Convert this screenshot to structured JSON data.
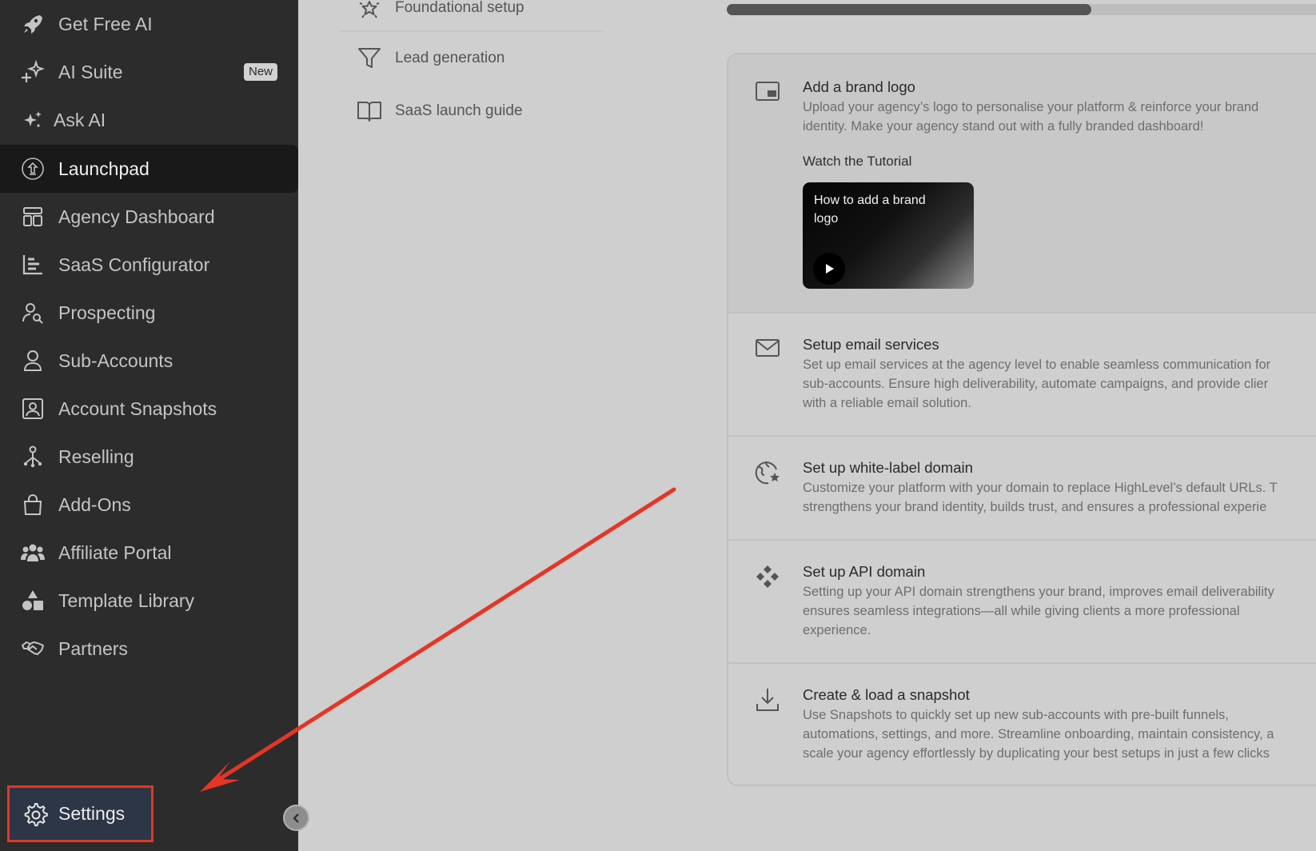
{
  "sidebar": {
    "items": [
      {
        "label": "Get Free AI",
        "icon": "rocket-icon"
      },
      {
        "label": "AI Suite",
        "icon": "sparkle-plus-icon",
        "badge": "New"
      },
      {
        "label": "Ask AI",
        "icon": "sparkles-icon"
      },
      {
        "label": "Launchpad",
        "icon": "launchpad-icon",
        "active": true
      },
      {
        "label": "Agency Dashboard",
        "icon": "dashboard-icon"
      },
      {
        "label": "SaaS Configurator",
        "icon": "bar-chart-icon"
      },
      {
        "label": "Prospecting",
        "icon": "user-search-icon"
      },
      {
        "label": "Sub-Accounts",
        "icon": "user-icon"
      },
      {
        "label": "Account Snapshots",
        "icon": "portrait-icon"
      },
      {
        "label": "Reselling",
        "icon": "network-icon"
      },
      {
        "label": "Add-Ons",
        "icon": "bag-icon"
      },
      {
        "label": "Affiliate Portal",
        "icon": "users-icon"
      },
      {
        "label": "Template Library",
        "icon": "shapes-icon"
      },
      {
        "label": "Partners",
        "icon": "handshake-icon"
      }
    ],
    "settings_label": "Settings"
  },
  "guides": {
    "items": [
      {
        "label": "Foundational setup",
        "icon": "star-sparkle-icon"
      },
      {
        "label": "Lead generation",
        "icon": "funnel-icon"
      },
      {
        "label": "SaaS launch guide",
        "icon": "book-icon"
      }
    ]
  },
  "progress": {
    "fraction": 0.6
  },
  "steps": [
    {
      "title": "Add a brand logo",
      "desc_lines": [
        "Upload your agency’s logo to personalise your platform & reinforce your brand",
        "identity. Make your agency stand out with a fully branded dashboard!"
      ],
      "tutorial_label": "Watch the Tutorial",
      "video_title": "How to add a brand logo"
    },
    {
      "title": "Setup email services",
      "desc_lines": [
        "Set up email services at the agency level to enable seamless communication for",
        "sub-accounts. Ensure high deliverability, automate campaigns, and provide clier",
        "with a reliable email solution."
      ]
    },
    {
      "title": "Set up white-label domain",
      "desc_lines": [
        "Customize your platform with your domain to replace HighLevel’s default URLs. T",
        "strengthens your brand identity, builds trust, and ensures a professional experie"
      ]
    },
    {
      "title": "Set up API domain",
      "desc_lines": [
        "Setting up your API domain strengthens your brand, improves email deliverability",
        "ensures seamless integrations—all while giving clients a more professional",
        "experience."
      ]
    },
    {
      "title": "Create & load a snapshot",
      "desc_lines": [
        "Use Snapshots to quickly set up new sub-accounts with pre-built funnels,",
        "automations, settings, and more. Streamline onboarding, maintain consistency, a",
        "scale your agency effortlessly by duplicating your best setups in just a few clicks"
      ]
    }
  ],
  "colors": {
    "sidebar_bg": "#2c2c2c",
    "annotation_red": "#e53525",
    "content_bg": "#cfcfcf"
  }
}
